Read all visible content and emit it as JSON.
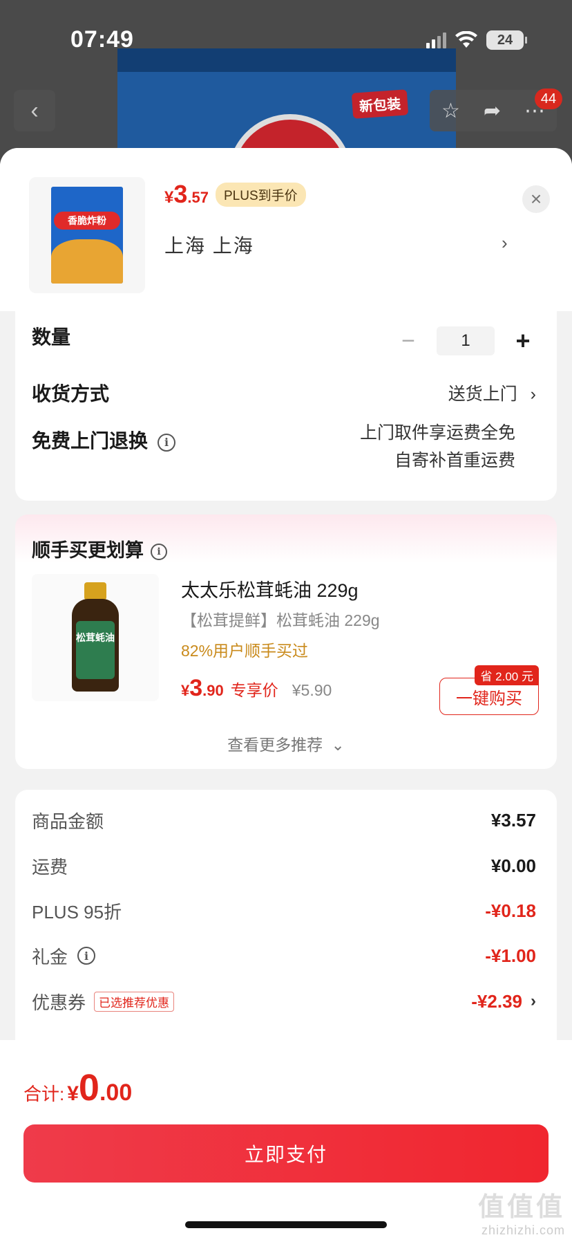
{
  "status": {
    "time": "07:49",
    "battery": "24"
  },
  "nav": {
    "cart_badge": "44"
  },
  "product_bg": {
    "badge": "新包装"
  },
  "header": {
    "price_currency": "¥",
    "price_int": "3",
    "price_dec": ".57",
    "plus_tag": "PLUS到手价",
    "address": "上海  上海",
    "thumb_label": "香脆炸粉"
  },
  "options": {
    "quantity_label": "数量",
    "quantity_value": "1",
    "delivery_label": "收货方式",
    "delivery_value": "送货上门",
    "return_label": "免费上门退换",
    "return_line1": "上门取件享运费全免",
    "return_line2": "自寄补首重运费"
  },
  "recommend": {
    "title": "顺手买更划算",
    "name": "太太乐松茸蚝油 229g",
    "subtitle": "【松茸提鲜】松茸蚝油 229g",
    "percent": "82%用户顺手买过",
    "price_currency": "¥",
    "price_int": "3",
    "price_dec": ".90",
    "price_tag": "专享价",
    "original_price": "¥5.90",
    "save_tag": "省 2.00 元",
    "buy_label": "一键购买",
    "more_label": "查看更多推荐",
    "bottle_label": "松茸蚝油"
  },
  "fees": [
    {
      "label": "商品金额",
      "value": "¥3.57"
    },
    {
      "label": "运费",
      "value": "¥0.00"
    },
    {
      "label": "PLUS 95折",
      "value": "-¥0.18"
    },
    {
      "label": "礼金",
      "value": "-¥1.00"
    },
    {
      "label": "优惠券",
      "value": "-¥2.39",
      "tag": "已选推荐优惠"
    }
  ],
  "footer": {
    "total_label": "合计:",
    "total_currency": "¥",
    "total_int": "0",
    "total_dec": ".00",
    "pay_label": "立即支付"
  },
  "watermark": {
    "main": "值值值",
    "sub": "zhizhizhi.com"
  }
}
